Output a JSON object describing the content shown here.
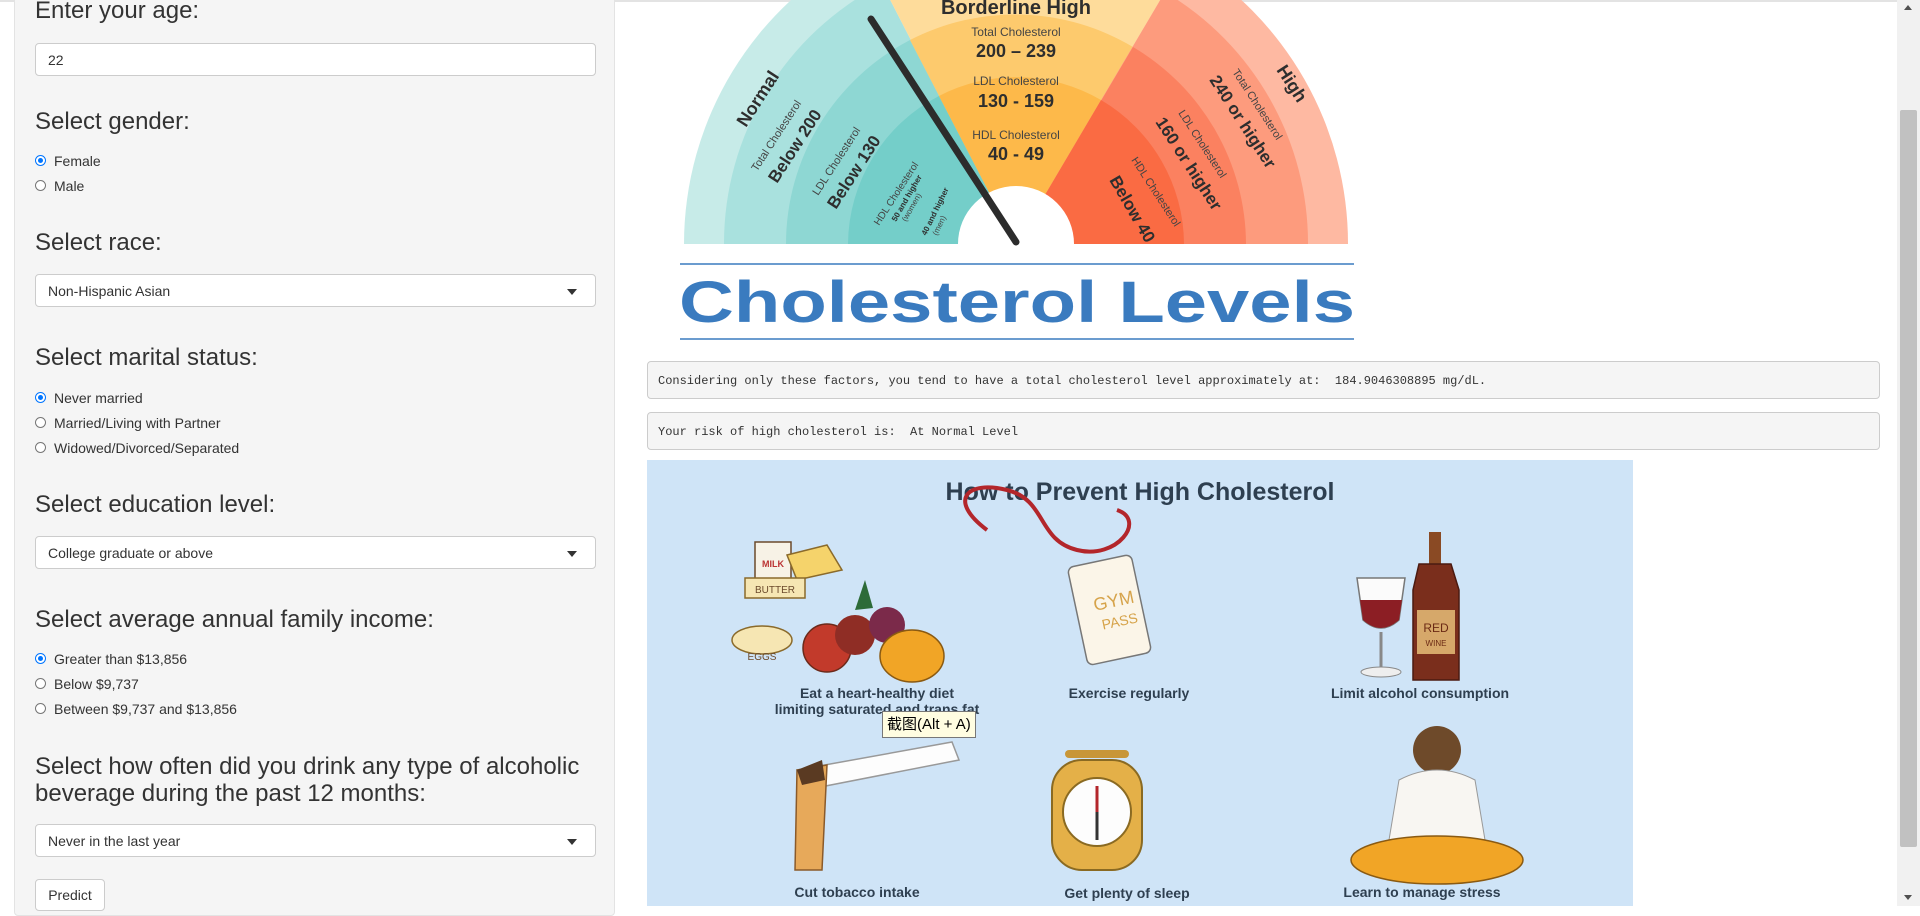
{
  "sidebar": {
    "age": {
      "label": "Enter your age:",
      "value": "22"
    },
    "gender": {
      "label": "Select gender:",
      "options": [
        "Female",
        "Male"
      ],
      "selected": 0
    },
    "race": {
      "label": "Select race:",
      "value": "Non-Hispanic Asian"
    },
    "marital": {
      "label": "Select marital status:",
      "options": [
        "Never married",
        "Married/Living with Partner",
        "Widowed/Divorced/Separated"
      ],
      "selected": 0
    },
    "education": {
      "label": "Select education level:",
      "value": "College graduate or above"
    },
    "income": {
      "label": "Select average annual family income:",
      "options": [
        "Greater than $13,856",
        "Below $9,737",
        "Between $9,737 and $13,856"
      ],
      "selected": 0
    },
    "alcohol": {
      "label_line1": "Select how often did you drink any type of alcoholic",
      "label_line2": "beverage during the past 12 months:",
      "value": "Never in the last year"
    },
    "predict_label": "Predict"
  },
  "gauge": {
    "title": "Cholesterol Levels",
    "normal": {
      "heading": "Normal",
      "total_label": "Total Cholesterol",
      "total_value": "Below 200",
      "ldl_label": "LDL Cholesterol",
      "ldl_value": "Below 130",
      "hdl_label": "HDL Cholesterol",
      "hdl_women": "50 and higher",
      "hdl_women_note": "(women)",
      "hdl_men": "40 and higher",
      "hdl_men_note": "(men)"
    },
    "borderline": {
      "heading": "Borderline High",
      "total_label": "Total Cholesterol",
      "total_value": "200 – 239",
      "ldl_label": "LDL Cholesterol",
      "ldl_value": "130 - 159",
      "hdl_label": "HDL Cholesterol",
      "hdl_value": "40 - 49"
    },
    "high": {
      "heading": "High",
      "total_label": "Total Cholesterol",
      "total_value": "240 or higher",
      "ldl_label": "LDL Cholesterol",
      "ldl_value": "160 or higher",
      "hdl_label": "HDL Cholesterol",
      "hdl_value": "Below 40"
    }
  },
  "result": {
    "level_text": "Considering only these factors, you tend to have a total cholesterol level approximately at:  184.9046308895 mg/dL.",
    "risk_text": "Your risk of high cholesterol is:  At Normal Level"
  },
  "prevention": {
    "title": "How to Prevent High Cholesterol",
    "diet_line1": "Eat a heart-healthy diet",
    "diet_line2": "limiting saturated and trans fat",
    "exercise": "Exercise regularly",
    "alcohol": "Limit alcohol consumption",
    "tobacco": "Cut tobacco intake",
    "sleep": "Get plenty of sleep",
    "stress": "Learn to manage stress",
    "food_words": {
      "milk": "MILK",
      "butter": "BUTTER",
      "eggs": "EGGS"
    },
    "gym_words": {
      "gym": "GYM",
      "pass": "PASS"
    },
    "wine_words": {
      "red": "RED",
      "wine": "WINE"
    }
  },
  "tooltip": "截图(Alt + A)",
  "icons": [
    "radio-icon",
    "caret-down-icon",
    "needle-icon",
    "scroll-arrow-up-icon",
    "scroll-arrow-down-icon"
  ],
  "colors": {
    "normal": "#7dd3cf",
    "borderline": "#fdb94a",
    "high": "#fa6b43",
    "title_blue": "#3a7bbf",
    "poster_bg": "#cfe4f7",
    "radio_accent": "#0075ff"
  }
}
